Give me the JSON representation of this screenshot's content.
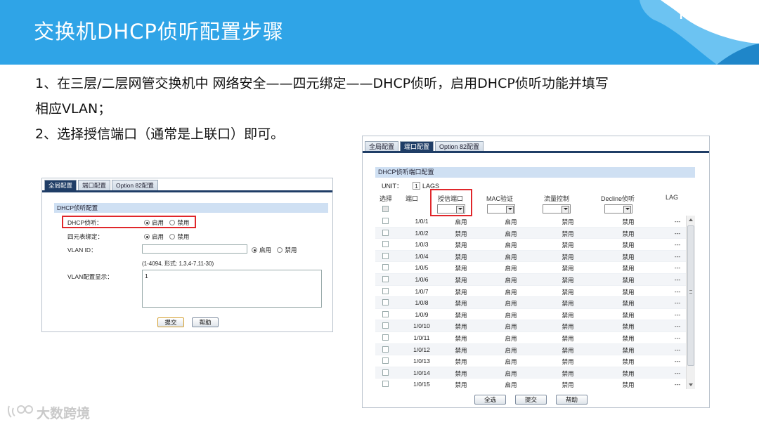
{
  "slide": {
    "title": "交换机DHCP侦听配置步骤",
    "logo": "TP-LINK",
    "line1": "1、在三层/二层网管交换机中 网络安全——四元绑定——DHCP侦听，启用DHCP侦听功能并填写",
    "line2": "相应VLAN；",
    "line3": "2、选择授信端口（通常是上联口）即可。",
    "watermark": "大数跨境",
    "colors": {
      "banner": "#2fa4e7",
      "highlight": "#e0272b",
      "tab_active": "#1f3d66"
    }
  },
  "left_panel": {
    "tabs": [
      "全局配置",
      "端口配置",
      "Option 82配置"
    ],
    "active_tab": 0,
    "section_title": "DHCP侦听配置",
    "dhcp_label": "DHCP侦听：",
    "bind_label": "四元表绑定：",
    "vlan_label": "VLAN ID：",
    "vlan_display_label": "VLAN配置显示：",
    "opt_enable": "启用",
    "opt_disable": "禁用",
    "vlan_hint": "(1-4094, 形式: 1,3,4-7,11-30)",
    "vlan_display_value": "1",
    "submit": "提交",
    "help": "帮助"
  },
  "right_panel": {
    "tabs": [
      "全局配置",
      "端口配置",
      "Option 82配置"
    ],
    "active_tab": 1,
    "section_title": "DHCP侦听端口配置",
    "unit_label": "UNIT：",
    "unit_value": "1",
    "lags_label": "LAGS",
    "headers": [
      "选择",
      "端口",
      "授信端口",
      "MAC验证",
      "流量控制",
      "Decline侦听",
      "LAG"
    ],
    "rows": [
      [
        "1/0/1",
        "启用",
        "启用",
        "禁用",
        "禁用",
        "---"
      ],
      [
        "1/0/2",
        "禁用",
        "启用",
        "禁用",
        "禁用",
        "---"
      ],
      [
        "1/0/3",
        "禁用",
        "启用",
        "禁用",
        "禁用",
        "---"
      ],
      [
        "1/0/4",
        "禁用",
        "启用",
        "禁用",
        "禁用",
        "---"
      ],
      [
        "1/0/5",
        "禁用",
        "启用",
        "禁用",
        "禁用",
        "---"
      ],
      [
        "1/0/6",
        "禁用",
        "启用",
        "禁用",
        "禁用",
        "---"
      ],
      [
        "1/0/7",
        "禁用",
        "启用",
        "禁用",
        "禁用",
        "---"
      ],
      [
        "1/0/8",
        "禁用",
        "启用",
        "禁用",
        "禁用",
        "---"
      ],
      [
        "1/0/9",
        "禁用",
        "启用",
        "禁用",
        "禁用",
        "---"
      ],
      [
        "1/0/10",
        "禁用",
        "启用",
        "禁用",
        "禁用",
        "---"
      ],
      [
        "1/0/11",
        "禁用",
        "启用",
        "禁用",
        "禁用",
        "---"
      ],
      [
        "1/0/12",
        "禁用",
        "启用",
        "禁用",
        "禁用",
        "---"
      ],
      [
        "1/0/13",
        "禁用",
        "启用",
        "禁用",
        "禁用",
        "---"
      ],
      [
        "1/0/14",
        "禁用",
        "启用",
        "禁用",
        "禁用",
        "---"
      ],
      [
        "1/0/15",
        "禁用",
        "启用",
        "禁用",
        "禁用",
        "---"
      ]
    ],
    "select_all": "全选",
    "submit": "提交",
    "help": "帮助"
  }
}
